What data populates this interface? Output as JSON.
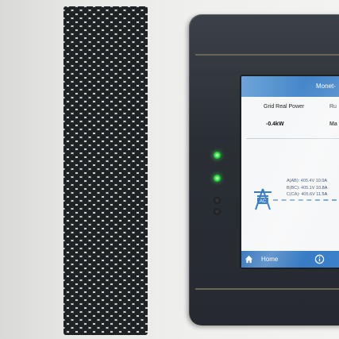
{
  "header": {
    "title": "Monet-"
  },
  "metrics": {
    "grid_label": "Grid Real Power",
    "grid_value": "-0.4kW",
    "second_label": "Ru",
    "second_value": "Ma"
  },
  "ac_panel": {
    "icon_label": "AC",
    "phases": [
      "A(AB): 405.4V 10.0A",
      "B(BC): 405.1V 10.8A",
      "C(CA): 405.6V 11.5A"
    ]
  },
  "bottom_bar": {
    "home_label": "Home"
  },
  "indicators": [
    {
      "name": "led-1",
      "state": "on",
      "color": "#38e04a"
    },
    {
      "name": "led-2",
      "state": "on",
      "color": "#38e04a"
    },
    {
      "name": "led-3",
      "state": "off",
      "color": "#151718"
    },
    {
      "name": "led-4",
      "state": "off",
      "color": "#151718"
    }
  ],
  "colors": {
    "accent": "#2f76c2",
    "panel": "#2a2f35",
    "cabinet": "#ececea"
  }
}
